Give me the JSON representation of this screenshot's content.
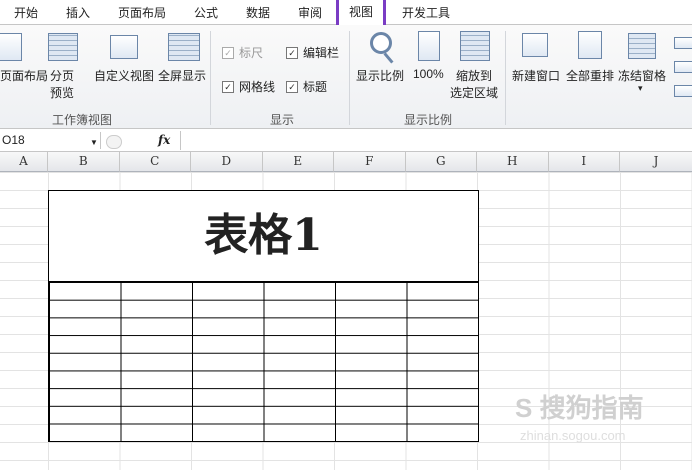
{
  "tabs": [
    "开始",
    "插入",
    "页面布局",
    "公式",
    "数据",
    "审阅",
    "视图",
    "开发工具"
  ],
  "ribbon": {
    "workbook_views": {
      "group_label": "工作簿视图",
      "page_layout": "页面布局",
      "page_break_line1": "分页",
      "page_break_line2": "预览",
      "custom_view": "自定义视图",
      "full_screen": "全屏显示"
    },
    "show": {
      "group_label": "显示",
      "ruler": "标尺",
      "formula_bar": "编辑栏",
      "gridlines": "网格线",
      "headings": "标题",
      "check": "✓"
    },
    "zoom": {
      "group_label": "显示比例",
      "zoom": "显示比例",
      "hundred": "100%",
      "zoom_sel_line1": "缩放到",
      "zoom_sel_line2": "选定区域"
    },
    "window": {
      "new_window": "新建窗口",
      "arrange_all": "全部重排",
      "freeze_panes": "冻结窗格",
      "arrow": "▾"
    }
  },
  "formula_bar": {
    "name_box": "O18",
    "dropdown": "▼",
    "fx": "fx",
    "value": ""
  },
  "columns": [
    "A",
    "B",
    "C",
    "D",
    "E",
    "F",
    "G",
    "H",
    "I",
    "J"
  ],
  "sheet": {
    "table_title": "表格1"
  },
  "watermark": {
    "main": "S 搜狗指南",
    "sub": "zhinan.sogou.com"
  }
}
